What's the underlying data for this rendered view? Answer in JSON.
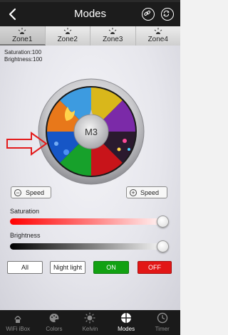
{
  "header": {
    "title": "Modes",
    "back_icon": "chevron-left-icon",
    "link_icon": "link-icon",
    "refresh_icon": "refresh-icon"
  },
  "zones": [
    {
      "label": "Zone1",
      "active": true
    },
    {
      "label": "Zone2",
      "active": false
    },
    {
      "label": "Zone3",
      "active": false
    },
    {
      "label": "Zone4",
      "active": false
    }
  ],
  "info": {
    "saturation_text": "Saturation:100",
    "brightness_text": "Brightness:100"
  },
  "wheel": {
    "center_label": "M3",
    "selected_segment_pointer": "red-arrow"
  },
  "speed": {
    "minus_label": "Speed",
    "plus_label": "Speed"
  },
  "sliders": {
    "saturation_label": "Saturation",
    "saturation_value": 100,
    "brightness_label": "Brightness",
    "brightness_value": 100
  },
  "buttons": {
    "all": "All",
    "night_light": "Night light",
    "on": "ON",
    "off": "OFF"
  },
  "colors": {
    "on_green": "#12a112",
    "off_red": "#e21616",
    "header_bg": "#1c1c1c"
  },
  "tabs": [
    {
      "label": "WiFi iBox",
      "icon": "wifi-box-icon",
      "active": false
    },
    {
      "label": "Colors",
      "icon": "palette-icon",
      "active": false
    },
    {
      "label": "Kelvin",
      "icon": "sun-icon",
      "active": false
    },
    {
      "label": "Modes",
      "icon": "modes-icon",
      "active": true
    },
    {
      "label": "Timer",
      "icon": "clock-icon",
      "active": false
    }
  ]
}
